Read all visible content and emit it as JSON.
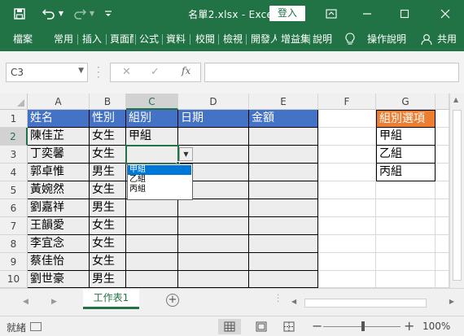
{
  "window": {
    "title": "名單2.xlsx  -  Excel",
    "login_label": "登入",
    "icons": [
      "save-icon",
      "undo-icon",
      "redo-icon",
      "customize-qat-icon",
      "ribbon-display-icon",
      "minimize-icon",
      "maximize-icon",
      "close-icon"
    ]
  },
  "ribbon": {
    "tabs": [
      "檔案",
      "常用",
      "插入",
      "頁面配置",
      "公式",
      "資料",
      "校閱",
      "檢視",
      "開發人員",
      "增益集",
      "說明"
    ],
    "tell_me": "操作說明",
    "share": "共用"
  },
  "formula_bar": {
    "name_box": "C3",
    "cancel": "✕",
    "enter": "✓",
    "fx": "fx",
    "content": ""
  },
  "columns": [
    "A",
    "B",
    "C",
    "D",
    "E",
    "F",
    "G"
  ],
  "rows": [
    "1",
    "2",
    "3",
    "4",
    "5",
    "6",
    "7",
    "8",
    "9",
    "10"
  ],
  "table": {
    "headers": [
      "姓名",
      "性別",
      "組別",
      "日期",
      "金額"
    ],
    "names": [
      "陳佳芷",
      "丁奕馨",
      "郭卓惟",
      "黃婉然",
      "劉嘉祥",
      "王韻愛",
      "李宜念",
      "蔡佳怡",
      "劉世豪"
    ],
    "genders": [
      "女生",
      "女生",
      "男生",
      "女生",
      "男生",
      "女生",
      "女生",
      "女生",
      "男生"
    ],
    "groups": [
      "甲組",
      "",
      "",
      "",
      "",
      "",
      "",
      "",
      ""
    ]
  },
  "options_table": {
    "header": "組別選項",
    "items": [
      "甲組",
      "乙組",
      "丙組"
    ]
  },
  "dropdown": {
    "items": [
      "甲組",
      "乙組",
      "丙組"
    ],
    "highlighted": 0
  },
  "sheet": {
    "active_tab": "工作表1",
    "add_label": "+"
  },
  "status": {
    "text": "就緒",
    "zoom": "100%"
  },
  "theme": {
    "excel_green": "#217346",
    "header_blue": "#4472c4",
    "header_orange": "#ed7d31",
    "shaded": "#ededed",
    "selection_blue": "#0078d7"
  }
}
